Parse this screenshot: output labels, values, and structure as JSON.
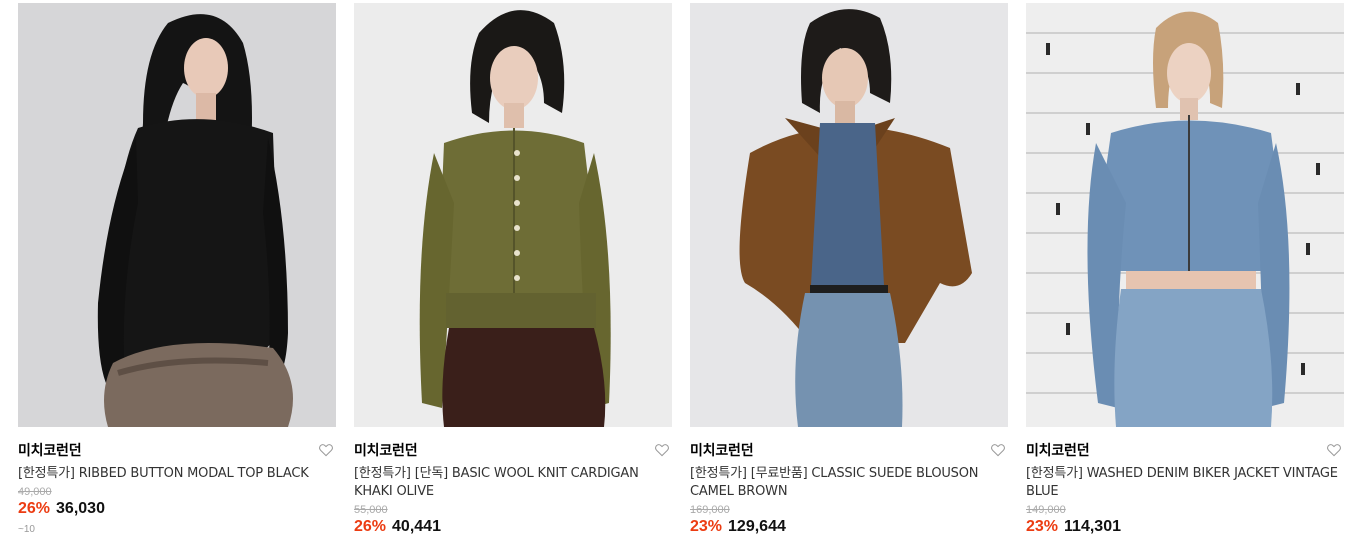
{
  "colors": {
    "discount": "#ec3c12",
    "brand_text": "#000000",
    "name_text": "#333333",
    "original_price": "#aaaaaa"
  },
  "products": [
    {
      "brand": "미치코런던",
      "name": "[한정특가] RIBBED BUTTON MODAL TOP BLACK",
      "original_price": "49,000",
      "discount": "26%",
      "price": "36,030",
      "extra": "~10",
      "image_icon": "model-photo-black-top"
    },
    {
      "brand": "미치코런던",
      "name": "[한정특가] [단독] BASIC WOOL KNIT CARDIGAN KHAKI OLIVE",
      "original_price": "55,000",
      "discount": "26%",
      "price": "40,441",
      "image_icon": "model-photo-olive-cardigan"
    },
    {
      "brand": "미치코런던",
      "name": "[한정특가] [무료반품] CLASSIC SUEDE BLOUSON CAMEL BROWN",
      "original_price": "169,000",
      "discount": "23%",
      "price": "129,644",
      "image_icon": "model-photo-suede-blouson"
    },
    {
      "brand": "미치코런던",
      "name": "[한정특가] WASHED DENIM BIKER JACKET VINTAGE BLUE",
      "original_price": "149,000",
      "discount": "23%",
      "price": "114,301",
      "image_icon": "model-photo-denim-jacket"
    }
  ]
}
